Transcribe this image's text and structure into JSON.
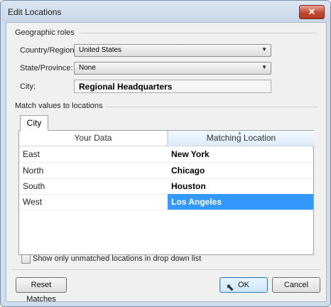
{
  "window": {
    "title": "Edit Locations",
    "close_glyph": "✕"
  },
  "geographic_roles": {
    "group_label": "Geographic roles",
    "country_label": "Country/Region:",
    "country_value": "United States",
    "state_label": "State/Province:",
    "state_value": "None",
    "city_label": "City:",
    "city_value": "Regional Headquarters"
  },
  "match": {
    "group_label": "Match values to locations",
    "tab_label": "City",
    "col_your_data": "Your Data",
    "col_matching": "Matching Location",
    "rows": [
      {
        "data": "East",
        "match": "New York"
      },
      {
        "data": "North",
        "match": "Chicago"
      },
      {
        "data": "South",
        "match": "Houston"
      },
      {
        "data": "West",
        "match": "Los Angeles"
      }
    ],
    "selected_row": "West"
  },
  "options": {
    "unmatched_label": "Show only unmatched locations in drop down list",
    "unmatched_checked": false
  },
  "buttons": {
    "reset": "Reset Matches",
    "ok": "OK",
    "cancel": "Cancel"
  },
  "icons": {
    "dropdown": "chevron-down-icon",
    "close": "close-icon",
    "sort": "sort-up-icon",
    "cursor": "mouse-pointer-icon"
  },
  "colors": {
    "selection": "#3399ff",
    "title_bar": "#cfdcec",
    "close_button": "#c5462f"
  }
}
